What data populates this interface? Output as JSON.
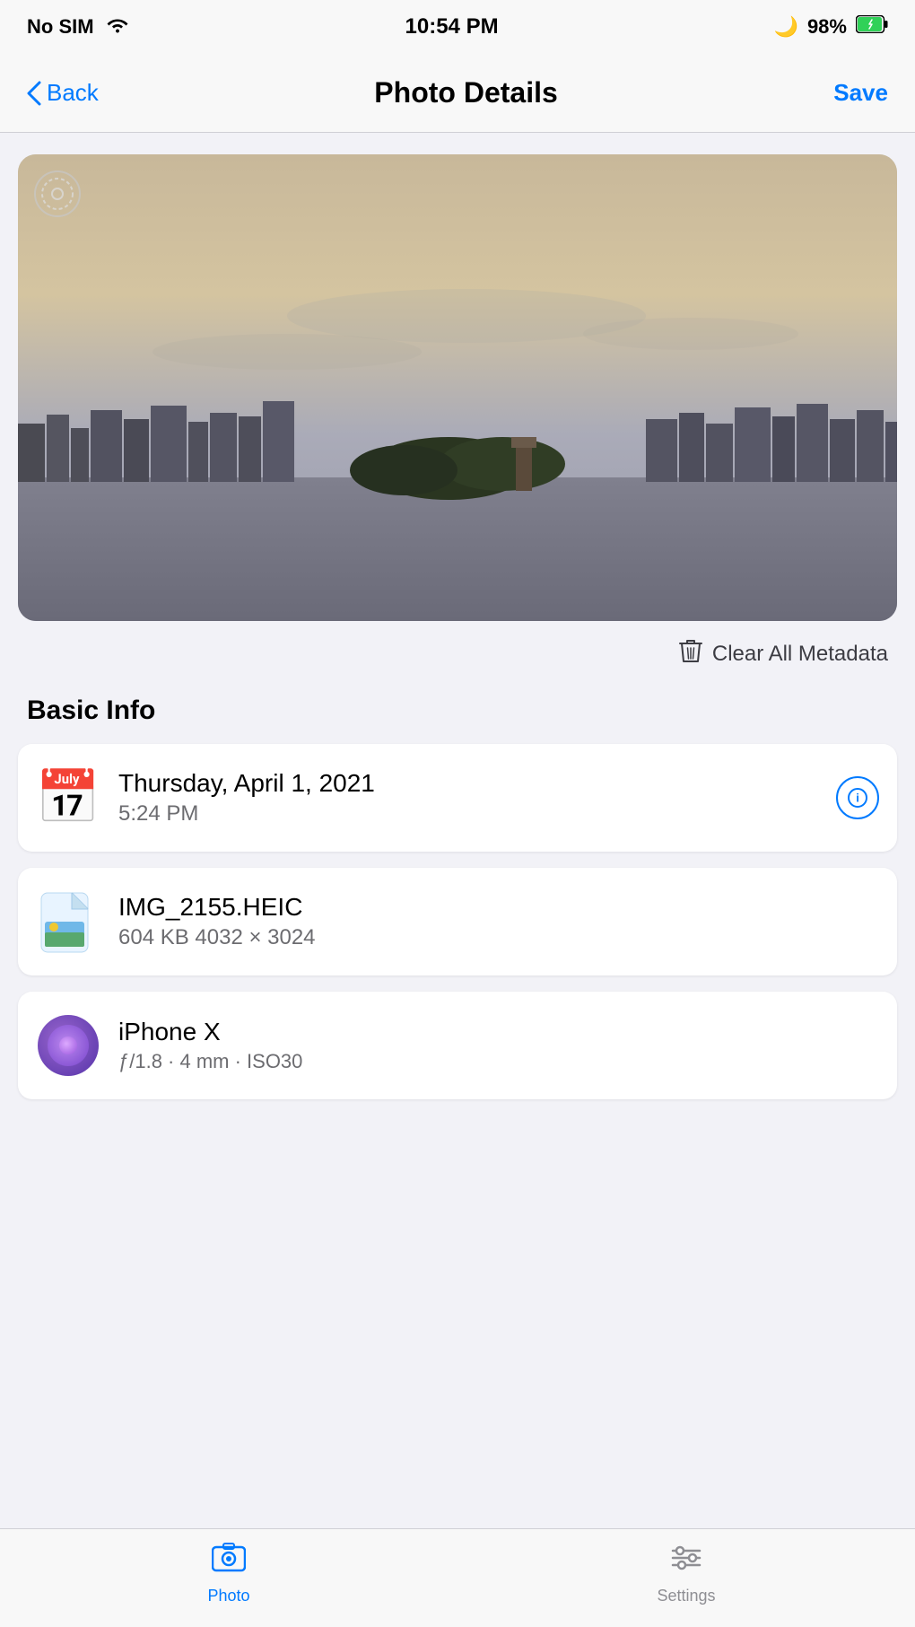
{
  "statusBar": {
    "carrier": "No SIM",
    "time": "10:54 PM",
    "battery": "98%"
  },
  "navBar": {
    "back": "Back",
    "title": "Photo Details",
    "save": "Save"
  },
  "photo": {
    "settingsIconLabel": "settings-ring"
  },
  "clearMetadata": {
    "label": "Clear All Metadata"
  },
  "basicInfo": {
    "sectionTitle": "Basic Info"
  },
  "cards": [
    {
      "id": "date-card",
      "title": "Thursday, April 1, 2021",
      "subtitle": "5:24 PM",
      "hasAction": true,
      "iconType": "calendar"
    },
    {
      "id": "file-card",
      "title": "IMG_2155.HEIC",
      "subtitle": "604 KB    4032 × 3024",
      "hasAction": false,
      "iconType": "file"
    },
    {
      "id": "device-card",
      "title": "iPhone X",
      "subtitle": "ƒ/1.8  ·  4 mm  ·  ISO30",
      "hasAction": false,
      "iconType": "camera",
      "truncated": true
    }
  ],
  "tabBar": {
    "tabs": [
      {
        "id": "photo",
        "label": "Photo",
        "active": true,
        "icon": "photo"
      },
      {
        "id": "settings",
        "label": "Settings",
        "active": false,
        "icon": "settings"
      }
    ]
  }
}
